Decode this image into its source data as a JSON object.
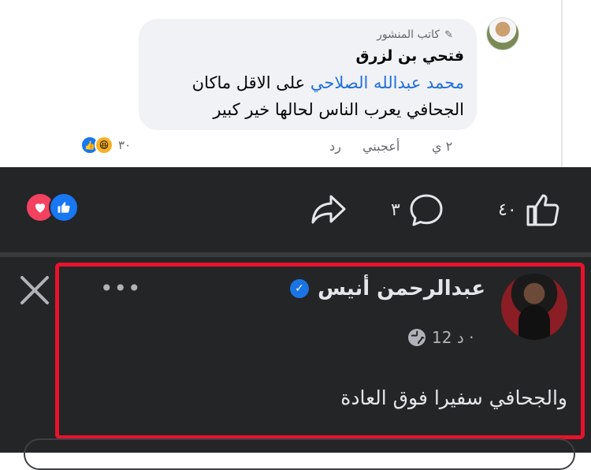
{
  "comment": {
    "author_tag": "كاتب المنشور",
    "author_tag_icon": "pencil-icon",
    "name": "فتحي بن لزرق",
    "mention": "محمد عبدالله الصلاحي",
    "text_after_mention": " على الاقل ماكان",
    "text_line2": "الجحافي يعرب الناس لحالها خير كبير",
    "time": "٢ ي",
    "like_label": "أعجبني",
    "reply_label": "رد",
    "reaction_count": "٣٠"
  },
  "post_bar": {
    "like_count": "٤٠",
    "comment_count": "٣",
    "reactions": [
      "heart-icon",
      "like-icon"
    ],
    "colors": {
      "heart": "#f3425f",
      "like": "#1877f2",
      "bar_bg": "#242526"
    }
  },
  "post": {
    "author": "عبدالرحمن أنيس",
    "verified": true,
    "time": "12 د ·",
    "text": "والجحافي سفيرا فوق العادة",
    "more_label": "•••",
    "highlight_color": "#e8122d"
  }
}
